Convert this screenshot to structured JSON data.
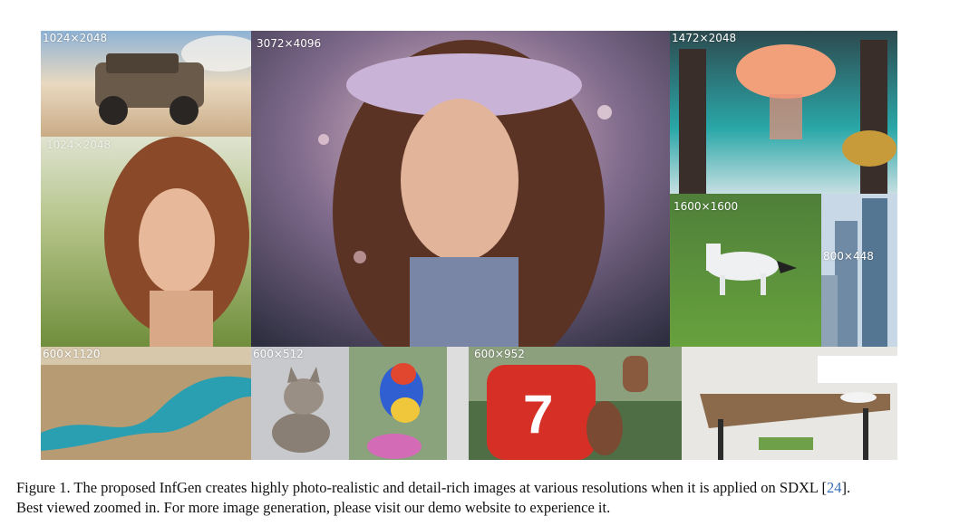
{
  "figure": {
    "tiles": [
      {
        "name": "suv-desert",
        "res": "1024×2048"
      },
      {
        "name": "woman-field",
        "res": "1024×2048"
      },
      {
        "name": "flower-crown-portrait",
        "res": "3072×4096"
      },
      {
        "name": "jellyfish-forest",
        "res": "1472×2048"
      },
      {
        "name": "white-horse",
        "res": "1600×1600"
      },
      {
        "name": "skyscrapers",
        "res": "800×448"
      },
      {
        "name": "river-canyon",
        "res": "600×1120"
      },
      {
        "name": "cat",
        "res": "600×512"
      },
      {
        "name": "colorful-bird",
        "res": ""
      },
      {
        "name": "football-player",
        "res": "600×952"
      },
      {
        "name": "table-interior",
        "res": ""
      }
    ]
  },
  "caption": {
    "prefix": "Figure 1. The proposed InfGen creates highly photo-realistic and detail-rich images at various resolutions when it is applied on SDXL [",
    "citation": "24",
    "suffix": "].",
    "line2": "Best viewed zoomed in. For more image generation, please visit our demo website to experience it."
  }
}
